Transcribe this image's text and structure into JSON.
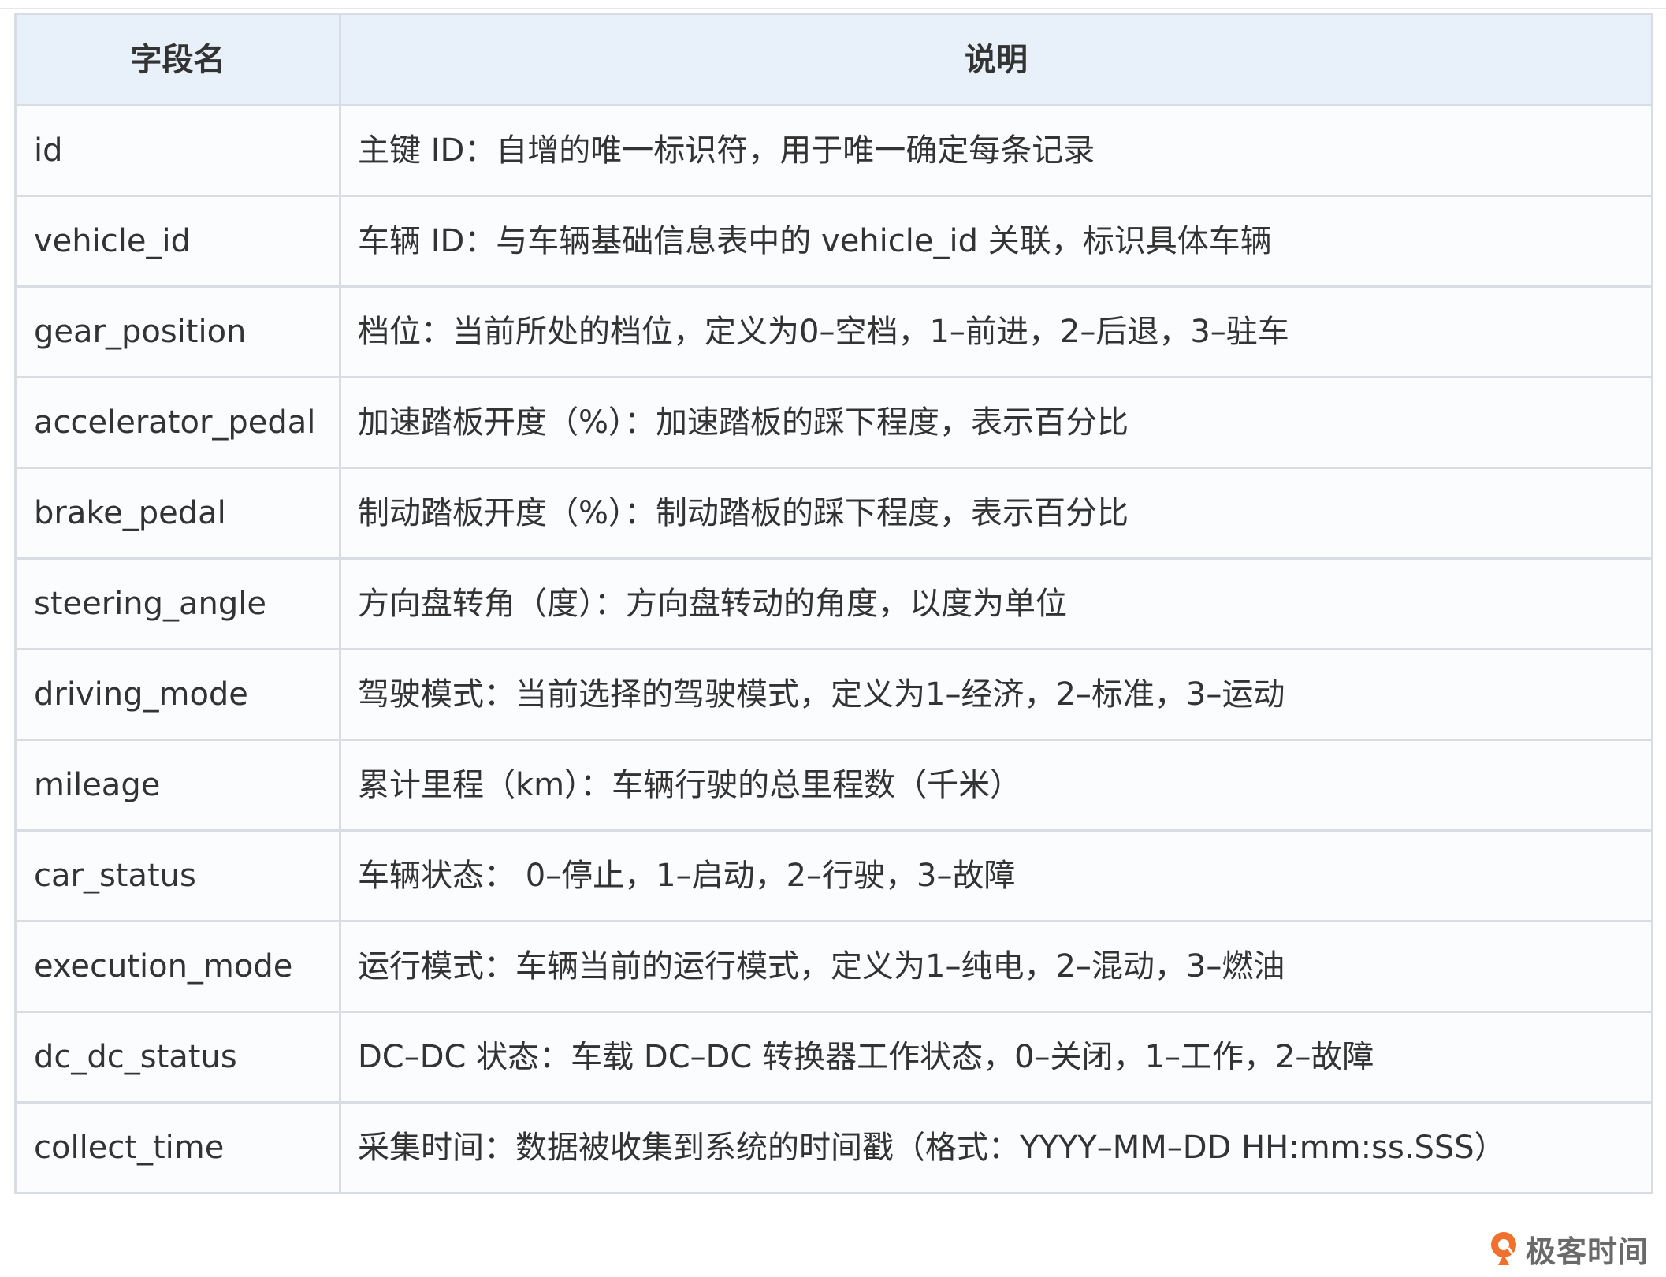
{
  "table": {
    "headers": [
      "字段名",
      "说明"
    ],
    "rows": [
      {
        "field": "id",
        "desc": "主键 ID：自增的唯一标识符，用于唯一确定每条记录"
      },
      {
        "field": "vehicle_id",
        "desc": "车辆 ID：与车辆基础信息表中的 vehicle_id 关联，标识具体车辆"
      },
      {
        "field": "gear_position",
        "desc": "档位：当前所处的档位，定义为0–空档，1–前进，2–后退，3–驻车"
      },
      {
        "field": "accelerator_pedal",
        "desc": "加速踏板开度（%）：加速踏板的踩下程度，表示百分比"
      },
      {
        "field": "brake_pedal",
        "desc": "制动踏板开度（%）：制动踏板的踩下程度，表示百分比"
      },
      {
        "field": "steering_angle",
        "desc": "方向盘转角（度）：方向盘转动的角度，以度为单位"
      },
      {
        "field": "driving_mode",
        "desc": "驾驶模式：当前选择的驾驶模式，定义为1–经济，2–标准，3–运动"
      },
      {
        "field": "mileage",
        "desc": "累计里程（km）：车辆行驶的总里程数（千米）"
      },
      {
        "field": "car_status",
        "desc": "车辆状态： 0–停止，1–启动，2–行驶，3–故障"
      },
      {
        "field": "execution_mode",
        "desc": "运行模式：车辆当前的运行模式，定义为1–纯电，2–混动，3–燃油"
      },
      {
        "field": "dc_dc_status",
        "desc": "DC–DC 状态：车载 DC–DC 转换器工作状态，0–关闭，1–工作，2–故障"
      },
      {
        "field": "collect_time",
        "desc": "采集时间：数据被收集到系统的时间戳（格式：YYYY–MM–DD HH:mm:ss.SSS）"
      }
    ]
  },
  "brand": {
    "text": "极客时间",
    "icon": "geektime-logo-icon",
    "color": "#f0702d"
  }
}
